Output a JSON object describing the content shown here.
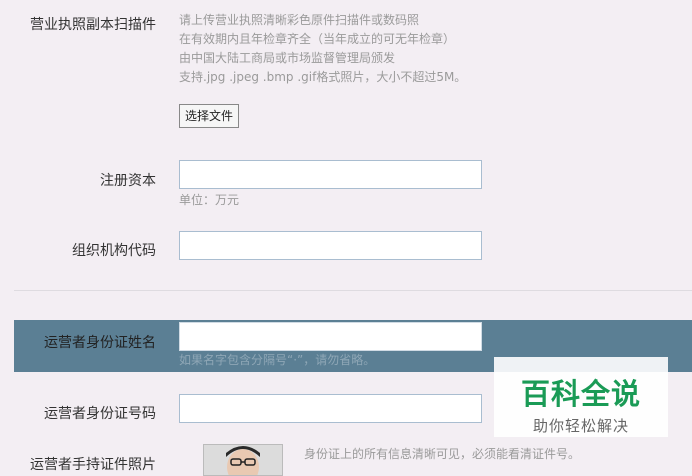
{
  "license_scan": {
    "label": "营业执照副本扫描件",
    "hints": [
      "请上传营业执照清晰彩色原件扫描件或数码照",
      "在有效期内且年检章齐全（当年成立的可无年检章）",
      "由中国大陆工商局或市场监督管理局颁发",
      "支持.jpg .jpeg .bmp .gif格式照片，大小不超过5M。"
    ],
    "choose_file_label": "选择文件"
  },
  "registered_capital": {
    "label": "注册资本",
    "value": "",
    "unit_hint": "单位：万元"
  },
  "org_code": {
    "label": "组织机构代码",
    "value": ""
  },
  "operator_name": {
    "label": "运营者身份证姓名",
    "value": "",
    "hint": "如果名字包含分隔号“·”，请勿省略。"
  },
  "operator_id_number": {
    "label": "运营者身份证号码",
    "value": ""
  },
  "operator_photo": {
    "label": "运营者手持证件照片",
    "hint": "身份证上的所有信息清晰可见，必须能看清证件号。"
  },
  "watermark": {
    "title": "百科全说",
    "subtitle": "助你轻松解决"
  },
  "colors": {
    "page_bg": "#f3eef3",
    "highlight_band": "#5b7f94",
    "watermark_green": "#1a9b56"
  }
}
